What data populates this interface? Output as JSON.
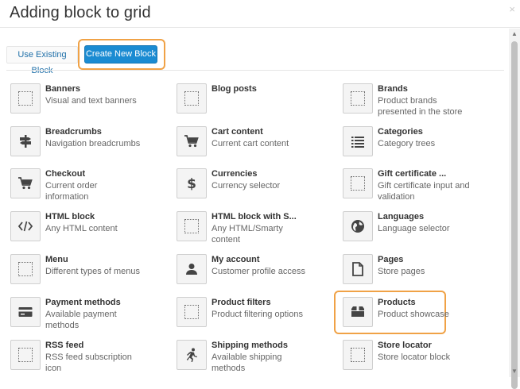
{
  "dialog": {
    "title": "Adding block to grid",
    "close_symbol": "×"
  },
  "buttons": {
    "use_existing": "Use Existing Block",
    "create_new": "Create New Block"
  },
  "colors": {
    "accent": "#1a8bd2",
    "highlight": "#f0a246"
  },
  "blocks": [
    {
      "name": "Banners",
      "desc": "Visual and text banners",
      "icon": "placeholder-icon"
    },
    {
      "name": "Blog posts",
      "desc": "",
      "icon": "placeholder-icon"
    },
    {
      "name": "Brands",
      "desc": "Product brands presented in the store",
      "icon": "placeholder-icon"
    },
    {
      "name": "Breadcrumbs",
      "desc": "Navigation breadcrumbs",
      "icon": "signpost-icon"
    },
    {
      "name": "Cart content",
      "desc": "Current cart content",
      "icon": "cart-icon"
    },
    {
      "name": "Categories",
      "desc": "Category trees",
      "icon": "list-icon"
    },
    {
      "name": "Checkout",
      "desc": "Current order information",
      "icon": "cart-icon"
    },
    {
      "name": "Currencies",
      "desc": "Currency selector",
      "icon": "dollar-icon"
    },
    {
      "name": "Gift certificate ...",
      "desc": "Gift certificate input and validation",
      "icon": "placeholder-icon"
    },
    {
      "name": "HTML block",
      "desc": "Any HTML content",
      "icon": "code-icon"
    },
    {
      "name": "HTML block with S...",
      "desc": "Any HTML/Smarty content",
      "icon": "placeholder-icon"
    },
    {
      "name": "Languages",
      "desc": "Language selector",
      "icon": "globe-icon"
    },
    {
      "name": "Menu",
      "desc": "Different types of menus",
      "icon": "placeholder-icon"
    },
    {
      "name": "My account",
      "desc": "Customer profile access",
      "icon": "user-icon"
    },
    {
      "name": "Pages",
      "desc": "Store pages",
      "icon": "page-icon"
    },
    {
      "name": "Payment methods",
      "desc": "Available payment methods",
      "icon": "credit-card-icon"
    },
    {
      "name": "Product filters",
      "desc": "Product filtering options",
      "icon": "placeholder-icon"
    },
    {
      "name": "Products",
      "desc": "Product showcase",
      "icon": "box-icon"
    },
    {
      "name": "RSS feed",
      "desc": "RSS feed subscription icon",
      "icon": "placeholder-icon"
    },
    {
      "name": "Shipping methods",
      "desc": "Available shipping methods",
      "icon": "runner-icon"
    },
    {
      "name": "Store locator",
      "desc": "Store locator block",
      "icon": "placeholder-icon"
    }
  ]
}
